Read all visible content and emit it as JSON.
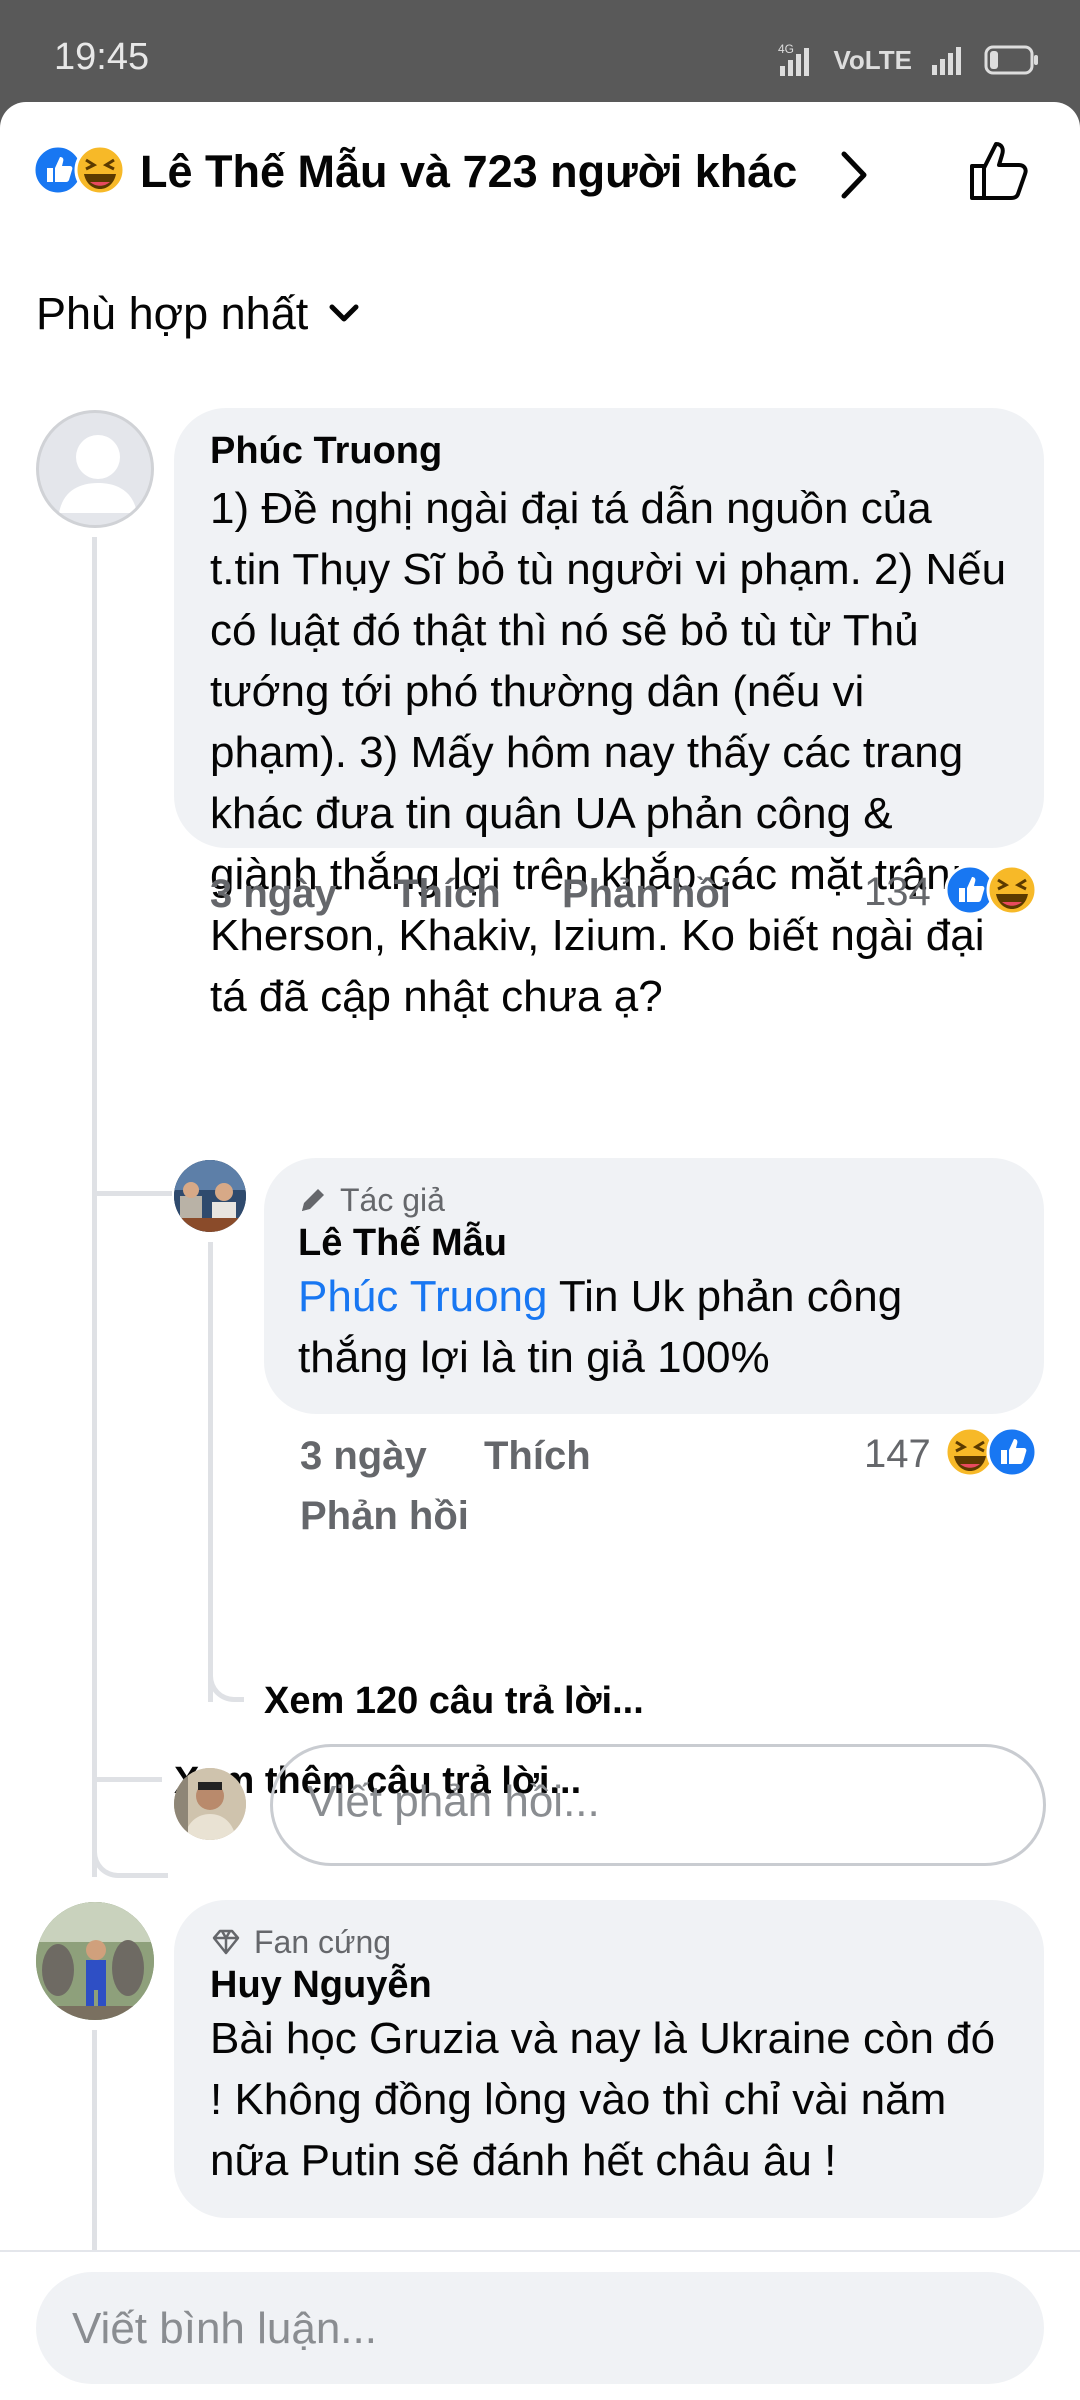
{
  "status_bar": {
    "time": "19:45",
    "network": "4G",
    "volte": "VoLTE"
  },
  "header": {
    "title": "Lê Thế Mẫu và 723 người khác"
  },
  "sort": {
    "label": "Phù hợp nhất"
  },
  "comments": [
    {
      "author": "Phúc Truong",
      "text": "1) Đề nghị ngài đại tá dẫn nguồn của t.tin Thụy Sĩ bỏ tù người vi phạm. 2) Nếu có luật đó thật thì nó sẽ bỏ tù từ Thủ tướng tới phó thường dân (nếu vi phạm). 3) Mấy hôm nay thấy các trang khác đưa tin quân UA phản công & giành thắng lợi trên khắp các mặt trận: Kherson, Khakiv, Izium. Ko biết ngài đại tá đã cập nhật chưa ạ?",
      "time": "3 ngày",
      "like": "Thích",
      "reply": "Phản hồi",
      "reaction_count": "134"
    },
    {
      "badge": "Fan cứng",
      "author": "Huy Nguyễn",
      "text": "Bài học Gruzia và nay là Ukraine còn đó ! Không đồng lòng vào thì chỉ vài năm nữa Putin sẽ đánh hết châu âu !"
    }
  ],
  "reply": {
    "badge": "Tác giả",
    "author": "Lê Thế Mẫu",
    "mention": "Phúc Truong",
    "text": " Tin Uk phản công thắng lợi là tin giả 100%",
    "time": "3 ngày",
    "like": "Thích",
    "reply": "Phản hồi",
    "reaction_count": "147"
  },
  "links": {
    "view_replies": "Xem 120 câu trả lời...",
    "view_more": "Xem thêm câu trả lời..."
  },
  "reply_input": {
    "placeholder": "Viết phản hồi..."
  },
  "comment_input": {
    "placeholder": "Viết bình luận..."
  },
  "colors": {
    "like_blue": "#1877f2",
    "haha_yellow": "#f7b928",
    "bubble_gray": "#f0f2f5",
    "meta_gray": "#65676b"
  },
  "icons": [
    "like-reaction-icon",
    "haha-reaction-icon",
    "chevron-right-icon",
    "thumbs-up-outline-icon",
    "chevron-down-icon",
    "pencil-icon",
    "diamond-icon"
  ]
}
